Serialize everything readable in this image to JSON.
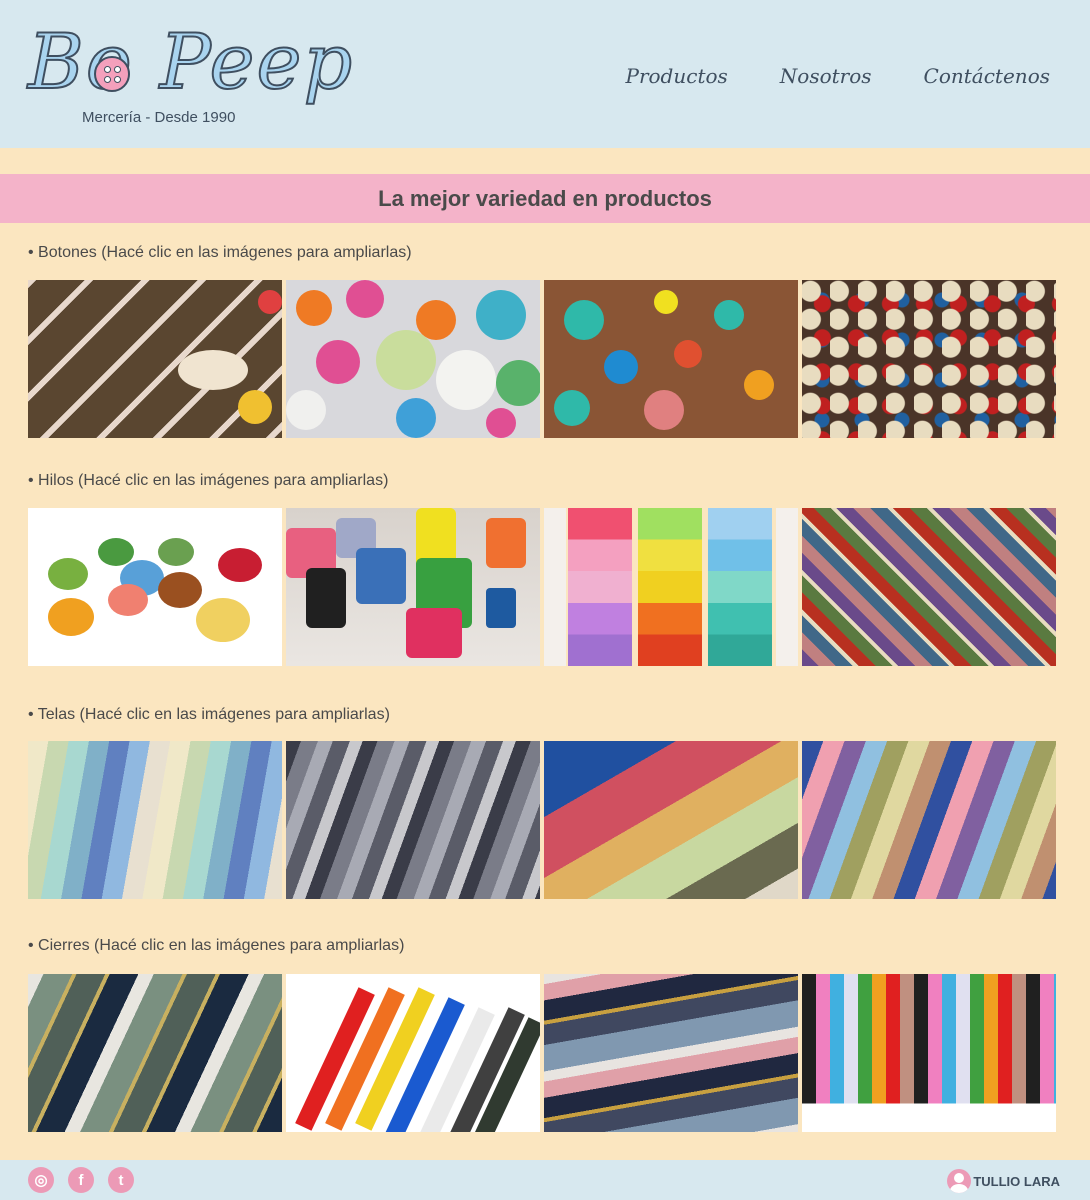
{
  "header": {
    "logo_text": "Bo Peep",
    "logo_subtitle": "Mercería - Desde 1990",
    "nav": [
      {
        "label": "Productos"
      },
      {
        "label": "Nosotros"
      },
      {
        "label": "Contáctenos"
      }
    ]
  },
  "banner": {
    "title": "La mejor variedad en productos"
  },
  "sections": [
    {
      "label": "• Botones (Hacé clic en las imágenes para ampliarlas)",
      "images": [
        "Botones 1",
        "Botones 2",
        "Botones 3",
        "Botones 4"
      ]
    },
    {
      "label": "• Hilos (Hacé clic en las imágenes para ampliarlas)",
      "images": [
        "Hilos 1",
        "Hilos 2",
        "Hilos 3",
        "Hilos 4"
      ]
    },
    {
      "label": "• Telas (Hacé clic en las imágenes para ampliarlas)",
      "images": [
        "Telas 1",
        "Telas 2",
        "Telas 3",
        "Telas 4"
      ]
    },
    {
      "label": "• Cierres (Hacé clic en las imágenes para ampliarlas)",
      "images": [
        "Cierres 1",
        "Cierres 2",
        "Cierres 3",
        "Cierres 4"
      ]
    }
  ],
  "footer": {
    "social": [
      {
        "icon": "instagram-icon",
        "glyph": "◎"
      },
      {
        "icon": "facebook-icon",
        "glyph": "f"
      },
      {
        "icon": "twitter-icon",
        "glyph": "t"
      }
    ],
    "author": "TULLIO LARA"
  },
  "colors": {
    "header_bg": "#d7e8ef",
    "page_bg": "#fbe6c0",
    "banner_bg": "#f4b3c9",
    "accent_pink": "#ec9ab6",
    "text_dark": "#3f4f60"
  }
}
